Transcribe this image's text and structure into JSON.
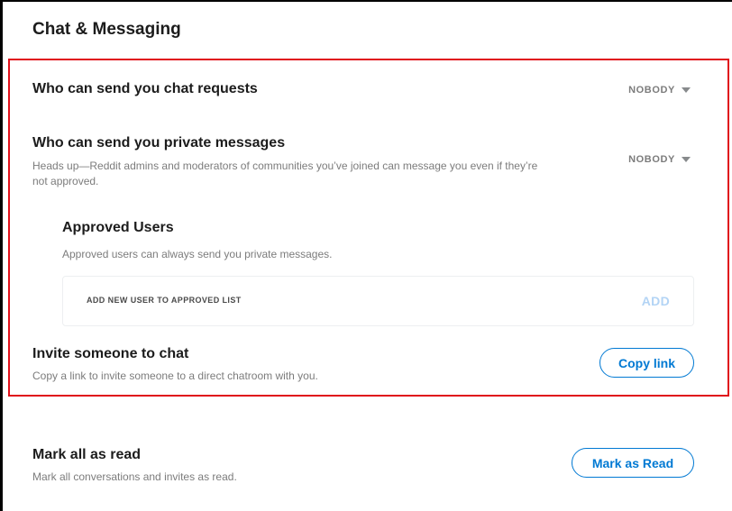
{
  "section": {
    "title": "Chat & Messaging"
  },
  "chat_requests": {
    "title": "Who can send you chat requests",
    "setting": "NOBODY"
  },
  "private_messages": {
    "title": "Who can send you private messages",
    "description": "Heads up—Reddit admins and moderators of communities you’ve joined can message you even if they’re not approved.",
    "setting": "NOBODY"
  },
  "approved_users": {
    "title": "Approved Users",
    "description": "Approved users can always send you private messages.",
    "input_placeholder": "ADD NEW USER TO APPROVED LIST",
    "add_label": "ADD"
  },
  "invite": {
    "title": "Invite someone to chat",
    "description": "Copy a link to invite someone to a direct chatroom with you.",
    "button_label": "Copy link"
  },
  "mark_read": {
    "title": "Mark all as read",
    "description": "Mark all conversations and invites as read.",
    "button_label": "Mark as Read"
  },
  "colors": {
    "accent": "#0079d3",
    "highlight_border": "#e0101a",
    "muted_text": "#7c7c7c",
    "disabled_accent": "#b3d4f5"
  },
  "icons": {
    "dropdown": "caret-down-icon"
  }
}
